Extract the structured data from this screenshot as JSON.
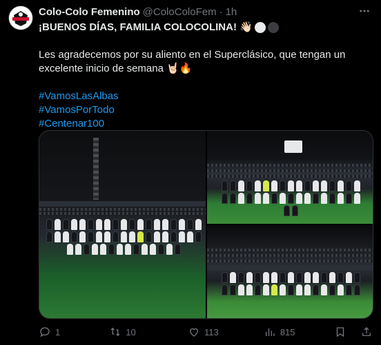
{
  "tweet": {
    "author_name": "Colo-Colo Femenino",
    "handle": "@ColoColoFem",
    "separator": "·",
    "time": "1h",
    "line1": "¡BUENOS DÍAS, FAMILIA COLOCOLINA! 👋🏻",
    "line2": "Les agradecemos por su aliento en el Superclásico, que tengan un",
    "line3": "excelente inicio de semana 🤘🏻🔥",
    "hashtags": [
      "#VamosLasAlbas",
      "#VamosPorTodo",
      "#Centenar100"
    ]
  },
  "media": {
    "photos": [
      {
        "name": "team-photo-1"
      },
      {
        "name": "team-photo-2"
      },
      {
        "name": "team-photo-3"
      }
    ]
  },
  "actions": {
    "reply_count": "1",
    "retweet_count": "10",
    "like_count": "113",
    "views_count": "815"
  },
  "icons": [
    "club-crest-icon",
    "more-icon",
    "reply-icon",
    "retweet-icon",
    "like-icon",
    "views-icon",
    "share-icon"
  ],
  "colors": {
    "background": "#000000",
    "text": "#e7e9ea",
    "muted": "#71767b",
    "link": "#1d9bf0",
    "border": "#2f3336"
  }
}
